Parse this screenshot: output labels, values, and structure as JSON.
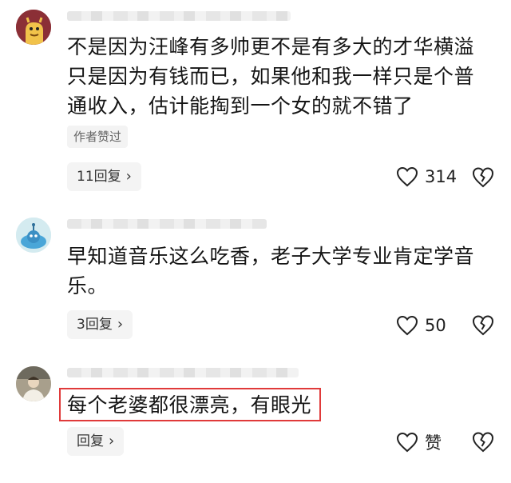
{
  "comments": [
    {
      "text": "不是因为汪峰有多帅更不是有多大的才华横溢只是因为有钱而已，如果他和我一样只是个普通收入，估计能掏到一个女的就不错了",
      "lines": [
        "不是因为汪峰有多帅更不是有多大的才华横溢",
        "只是因为有钱而已，如果他和我一样只是个普",
        "通收入，估计能掏到一个女的就不错了"
      ],
      "tag": "作者赞过",
      "reply_label": "11回复",
      "like_count": "314"
    },
    {
      "text": "早知道音乐这么吃香，老子大学专业肯定学音乐。",
      "lines": [
        "早知道音乐这么吃香，老子大学专业肯定学音",
        "乐。"
      ],
      "reply_label": "3回复",
      "like_count": "50"
    },
    {
      "text": "每个老婆都很漂亮，有眼光",
      "lines": [
        "每个老婆都很漂亮，有眼光"
      ],
      "reply_label": "回复",
      "like_count": "赞"
    }
  ],
  "icons": {
    "reply_chevron": "›",
    "like": "heart-outline-icon",
    "dislike": "broken-heart-icon"
  },
  "colors": {
    "highlight_border": "#e03a3a"
  }
}
